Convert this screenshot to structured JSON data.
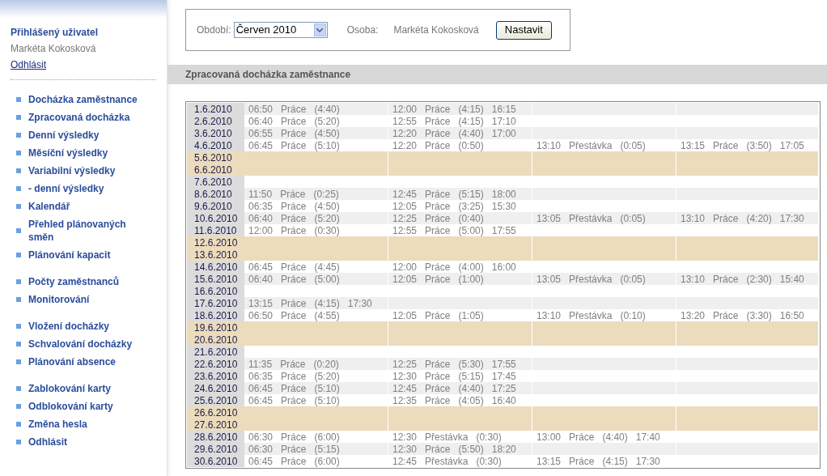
{
  "user_panel": {
    "heading": "Přihlášený uživatel",
    "name": "Markéta Kokosková",
    "logout": "Odhlásit"
  },
  "menu_groups": [
    [
      "Docházka zaměstnance",
      "Zpracovaná docházka",
      "Denní výsledky",
      "Měsíční výsledky",
      "Variabilní výsledky",
      "- denní výsledky",
      "Kalendář",
      "Přehled plánovaných směn",
      "Plánování kapacit"
    ],
    [
      "Počty zaměstnanců",
      "Monitorování"
    ],
    [
      "Vložení docházky",
      "Schvalování docházky",
      "Plánování absence"
    ],
    [
      "Zablokování karty",
      "Odblokování karty",
      "Změna hesla",
      "Odhlásit"
    ]
  ],
  "filter": {
    "period_label": "Období:",
    "period_value": "Červen 2010",
    "person_label": "Osoba:",
    "person_value": "Markéta Kokosková",
    "button": "Nastavit"
  },
  "section_title": "Zpracovaná docházka zaměstnance",
  "rows": [
    {
      "date": "1.6.2010",
      "kind": "shaded",
      "segments": [
        {
          "start": "06:50",
          "type": "Práce",
          "duration": "(4:40)"
        },
        {
          "start": "12:00",
          "type": "Práce",
          "duration": "(4:15)",
          "end": "16:15"
        }
      ]
    },
    {
      "date": "2.6.2010",
      "kind": "plain",
      "segments": [
        {
          "start": "06:40",
          "type": "Práce",
          "duration": "(5:20)"
        },
        {
          "start": "12:55",
          "type": "Práce",
          "duration": "(4:15)",
          "end": "17:10"
        }
      ]
    },
    {
      "date": "3.6.2010",
      "kind": "shaded",
      "segments": [
        {
          "start": "06:55",
          "type": "Práce",
          "duration": "(4:50)"
        },
        {
          "start": "12:20",
          "type": "Práce",
          "duration": "(4:40)",
          "end": "17:00"
        }
      ]
    },
    {
      "date": "4.6.2010",
      "kind": "plain",
      "segments": [
        {
          "start": "06:45",
          "type": "Práce",
          "duration": "(5:10)"
        },
        {
          "start": "12:20",
          "type": "Práce",
          "duration": "(0:50)"
        },
        {
          "start": "13:10",
          "type": "Přestávka",
          "duration": "(0:05)"
        },
        {
          "start": "13:15",
          "type": "Práce",
          "duration": "(3:50)",
          "end": "17:05"
        }
      ]
    },
    {
      "date": "5.6.2010",
      "kind": "weekend",
      "segments": []
    },
    {
      "date": "6.6.2010",
      "kind": "weekend",
      "segments": []
    },
    {
      "date": "7.6.2010",
      "kind": "plain",
      "segments": []
    },
    {
      "date": "8.6.2010",
      "kind": "shaded",
      "segments": [
        {
          "start": "11:50",
          "type": "Práce",
          "duration": "(0:25)"
        },
        {
          "start": "12:45",
          "type": "Práce",
          "duration": "(5:15)",
          "end": "18:00"
        }
      ]
    },
    {
      "date": "9.6.2010",
      "kind": "plain",
      "segments": [
        {
          "start": "06:35",
          "type": "Práce",
          "duration": "(4:50)"
        },
        {
          "start": "12:05",
          "type": "Práce",
          "duration": "(3:25)",
          "end": "15:30"
        }
      ]
    },
    {
      "date": "10.6.2010",
      "kind": "shaded",
      "segments": [
        {
          "start": "06:40",
          "type": "Práce",
          "duration": "(5:20)"
        },
        {
          "start": "12:25",
          "type": "Práce",
          "duration": "(0:40)"
        },
        {
          "start": "13:05",
          "type": "Přestávka",
          "duration": "(0:05)"
        },
        {
          "start": "13:10",
          "type": "Práce",
          "duration": "(4:20)",
          "end": "17:30"
        }
      ]
    },
    {
      "date": "11.6.2010",
      "kind": "plain",
      "segments": [
        {
          "start": "12:00",
          "type": "Práce",
          "duration": "(0:30)"
        },
        {
          "start": "12:55",
          "type": "Práce",
          "duration": "(5:00)",
          "end": "17:55"
        }
      ]
    },
    {
      "date": "12.6.2010",
      "kind": "weekend",
      "segments": []
    },
    {
      "date": "13.6.2010",
      "kind": "weekend",
      "segments": []
    },
    {
      "date": "14.6.2010",
      "kind": "plain",
      "segments": [
        {
          "start": "06:45",
          "type": "Práce",
          "duration": "(4:45)"
        },
        {
          "start": "12:00",
          "type": "Práce",
          "duration": "(4:00)",
          "end": "16:00"
        }
      ]
    },
    {
      "date": "15.6.2010",
      "kind": "shaded",
      "segments": [
        {
          "start": "06:40",
          "type": "Práce",
          "duration": "(5:00)"
        },
        {
          "start": "12:05",
          "type": "Práce",
          "duration": "(1:00)"
        },
        {
          "start": "13:05",
          "type": "Přestávka",
          "duration": "(0:05)"
        },
        {
          "start": "13:10",
          "type": "Práce",
          "duration": "(2:30)",
          "end": "15:40"
        }
      ]
    },
    {
      "date": "16.6.2010",
      "kind": "plain",
      "segments": []
    },
    {
      "date": "17.6.2010",
      "kind": "shaded",
      "segments": [
        {
          "start": "13:15",
          "type": "Práce",
          "duration": "(4:15)",
          "end": "17:30"
        }
      ]
    },
    {
      "date": "18.6.2010",
      "kind": "plain",
      "segments": [
        {
          "start": "06:50",
          "type": "Práce",
          "duration": "(4:55)"
        },
        {
          "start": "12:05",
          "type": "Práce",
          "duration": "(1:05)"
        },
        {
          "start": "13:10",
          "type": "Přestávka",
          "duration": "(0:10)"
        },
        {
          "start": "13:20",
          "type": "Práce",
          "duration": "(3:30)",
          "end": "16:50"
        }
      ]
    },
    {
      "date": "19.6.2010",
      "kind": "weekend",
      "segments": []
    },
    {
      "date": "20.6.2010",
      "kind": "weekend",
      "segments": []
    },
    {
      "date": "21.6.2010",
      "kind": "plain",
      "segments": []
    },
    {
      "date": "22.6.2010",
      "kind": "shaded",
      "segments": [
        {
          "start": "11:35",
          "type": "Práce",
          "duration": "(0:20)"
        },
        {
          "start": "12:25",
          "type": "Práce",
          "duration": "(5:30)",
          "end": "17:55"
        }
      ]
    },
    {
      "date": "23.6.2010",
      "kind": "plain",
      "segments": [
        {
          "start": "06:35",
          "type": "Práce",
          "duration": "(5:20)"
        },
        {
          "start": "12:30",
          "type": "Práce",
          "duration": "(5:15)",
          "end": "17:45"
        }
      ]
    },
    {
      "date": "24.6.2010",
      "kind": "shaded",
      "segments": [
        {
          "start": "06:45",
          "type": "Práce",
          "duration": "(5:10)"
        },
        {
          "start": "12:45",
          "type": "Práce",
          "duration": "(4:40)",
          "end": "17:25"
        }
      ]
    },
    {
      "date": "25.6.2010",
      "kind": "plain",
      "segments": [
        {
          "start": "06:45",
          "type": "Práce",
          "duration": "(5:10)"
        },
        {
          "start": "12:35",
          "type": "Práce",
          "duration": "(4:05)",
          "end": "16:40"
        }
      ]
    },
    {
      "date": "26.6.2010",
      "kind": "weekend",
      "segments": []
    },
    {
      "date": "27.6.2010",
      "kind": "weekend",
      "segments": []
    },
    {
      "date": "28.6.2010",
      "kind": "plain",
      "segments": [
        {
          "start": "06:30",
          "type": "Práce",
          "duration": "(6:00)"
        },
        {
          "start": "12:30",
          "type": "Přestávka",
          "duration": "(0:30)"
        },
        {
          "start": "13:00",
          "type": "Práce",
          "duration": "(4:40)",
          "end": "17:40"
        }
      ]
    },
    {
      "date": "29.6.2010",
      "kind": "shaded",
      "segments": [
        {
          "start": "06:30",
          "type": "Práce",
          "duration": "(5:15)"
        },
        {
          "start": "12:30",
          "type": "Práce",
          "duration": "(5:50)",
          "end": "18:20"
        }
      ]
    },
    {
      "date": "30.6.2010",
      "kind": "plain",
      "segments": [
        {
          "start": "06:45",
          "type": "Práce",
          "duration": "(6:00)"
        },
        {
          "start": "12:45",
          "type": "Přestávka",
          "duration": "(0:30)"
        },
        {
          "start": "13:15",
          "type": "Práce",
          "duration": "(4:15)",
          "end": "17:30"
        }
      ]
    }
  ]
}
